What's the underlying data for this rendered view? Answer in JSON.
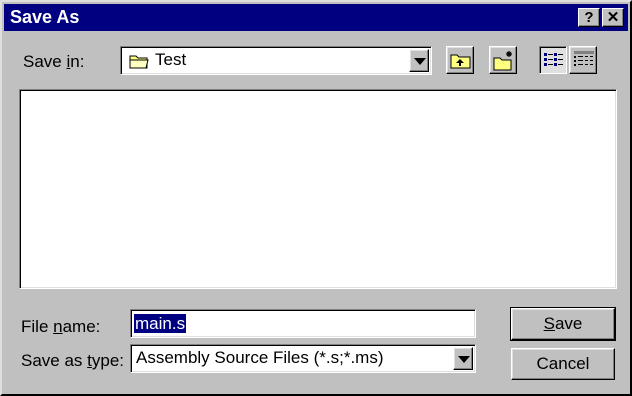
{
  "window": {
    "title": "Save As",
    "help_glyph": "?",
    "close_glyph": "✕"
  },
  "save_in": {
    "label_pre": "Save ",
    "label_accel": "i",
    "label_post": "n:",
    "folder_icon": "folder-icon",
    "value": "Test"
  },
  "toolbar": {
    "up_icon": "up-one-level-icon",
    "new_folder_icon": "new-folder-icon",
    "list_view_icon": "list-view-icon",
    "details_view_icon": "details-view-icon"
  },
  "file_name": {
    "label_pre": "File ",
    "label_accel": "n",
    "label_post": "ame:",
    "value": "main.s"
  },
  "save_as_type": {
    "label_pre": "Save as ",
    "label_accel": "t",
    "label_post": "ype:",
    "value": "Assembly Source Files (*.s;*.ms)"
  },
  "buttons": {
    "save_accel": "S",
    "save_rest": "ave",
    "cancel": "Cancel"
  },
  "colors": {
    "face": "#c0c0c0",
    "titlebar": "#000080",
    "highlight": "#000080"
  }
}
